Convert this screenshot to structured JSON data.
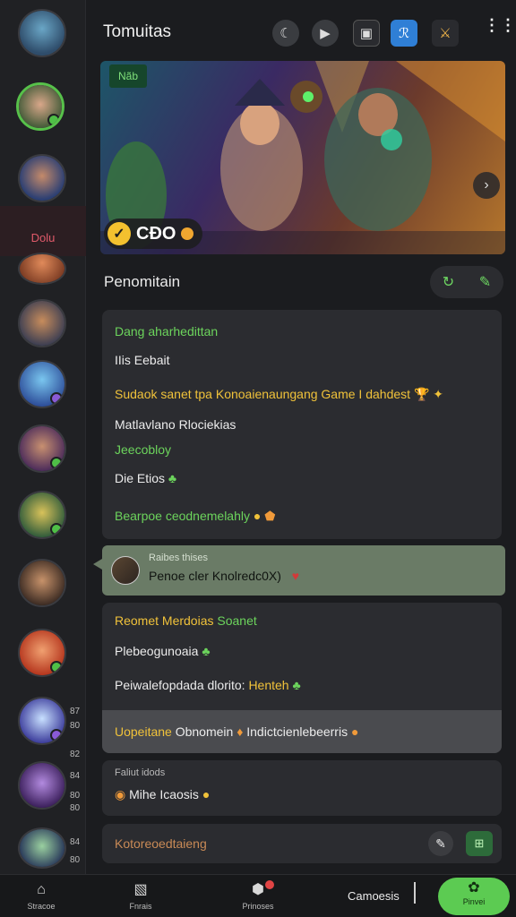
{
  "header": {
    "title": "Tomuitas",
    "icons": [
      "moon-icon",
      "play-icon",
      "image-icon",
      "app-logo-icon",
      "crossed-swords-icon",
      "more-icon"
    ]
  },
  "banner": {
    "tag": "Nãb",
    "badge_text": "CĐO"
  },
  "rail": {
    "label": "Dolu",
    "tags": [
      "87",
      "80",
      "82",
      "84",
      "80",
      "80",
      "84",
      "80"
    ]
  },
  "section": {
    "title": "Penomitain"
  },
  "card1": {
    "lines": [
      "Dang aharhedittan",
      "IIis Eebait",
      "Sudaok sanet tpa Konoaienaungang",
      "Game I dahdest",
      "Matlavlano Rlociekias",
      "Jeecobloy",
      "Die Etios",
      "Bearpoe ceodnemelahly"
    ]
  },
  "reply": {
    "meta": "Raibes thises",
    "text": "Penoe cler Knolredc0X)"
  },
  "card2": {
    "lines": [
      "Reomet Merdoias",
      "Soanet",
      "Plebeogunoaia",
      "Peiwalefopdada dlorito:",
      "Henteh",
      "Uopeitane",
      "Obnomein",
      "Indictcienlebeerris"
    ]
  },
  "card3": {
    "meta": "Faliut idods",
    "text": "Mihe Icaosis"
  },
  "composer": {
    "placeholder": "Kotoreoedtaieng"
  },
  "bottom_nav": {
    "items": [
      {
        "label": "Stracoe",
        "icon": "home-icon"
      },
      {
        "label": "Fnrais",
        "icon": "photos-icon"
      },
      {
        "label": "Prinoses",
        "icon": "shield-icon"
      }
    ],
    "center_text": "Camoesis",
    "active_label": "Pinvei"
  },
  "colors": {
    "accent_green": "#5ccb52",
    "highlight_yellow": "#f0c23a",
    "background": "#1b1c1f"
  }
}
